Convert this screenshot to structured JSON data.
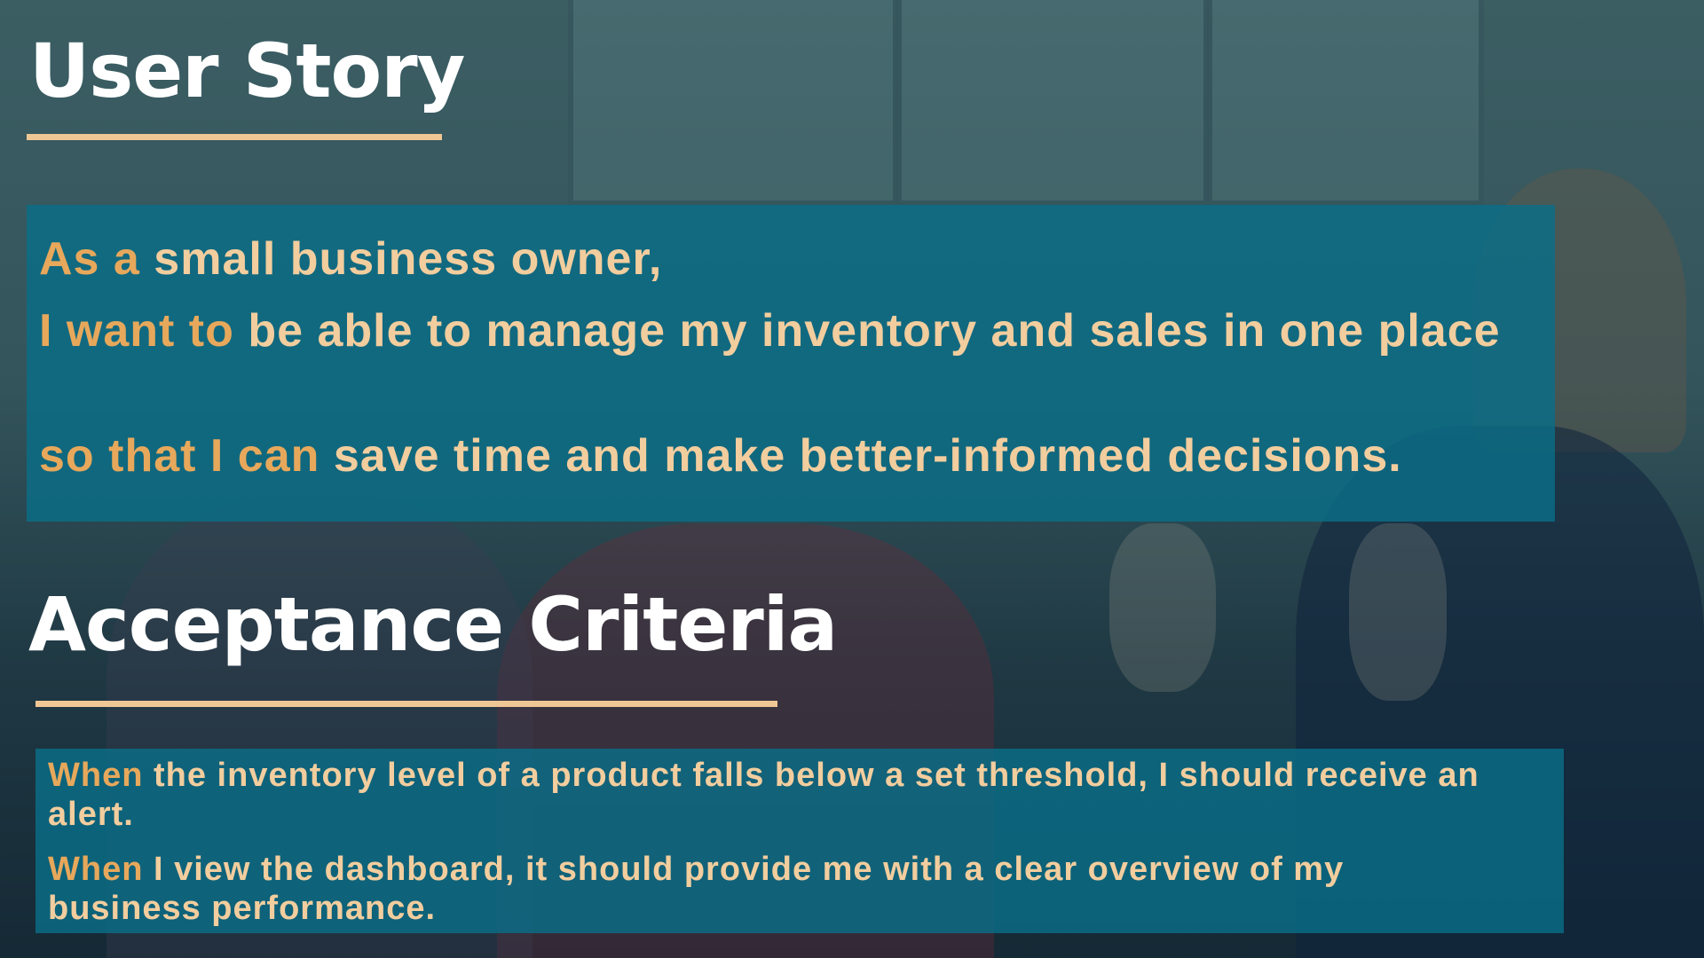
{
  "story_title": "User Story",
  "story": {
    "line1": {
      "keyword": "As a",
      "text": " small business owner,"
    },
    "line2": {
      "keyword": "I want to",
      "text": " be able to manage my inventory and sales in one place"
    },
    "line3": {
      "keyword": "so that I can",
      "text": " save time and make better-informed decisions."
    }
  },
  "criteria_title": "Acceptance Criteria",
  "criteria": [
    {
      "keyword": "When",
      "text": " the inventory level of a product falls below a set threshold, I should receive an alert."
    },
    {
      "keyword": "When",
      "text": " I view the dashboard, it should provide me with a clear overview of my business performance."
    }
  ],
  "colors": {
    "accent_line": "#efc795",
    "keyword": "#e7a85b",
    "body_text": "#f2cd9e",
    "panel": "#0a6e87",
    "title": "#ffffff"
  }
}
